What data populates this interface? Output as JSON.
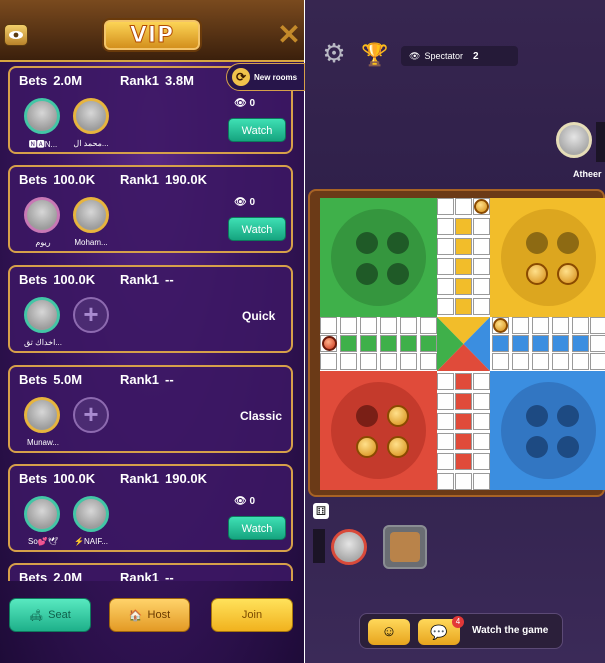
{
  "left": {
    "title": "VIP",
    "new_rooms_label": "New rooms",
    "rooms": [
      {
        "bets_label": "Bets",
        "bets": "2.0M",
        "rank_label": "Rank1",
        "rank": "3.8M",
        "players": [
          "🅽🅰N...",
          "محمد ال..."
        ],
        "watchers": "0",
        "action": "Watch"
      },
      {
        "bets_label": "Bets",
        "bets": "100.0K",
        "rank_label": "Rank1",
        "rank": "190.0K",
        "players": [
          "ريوم",
          "Moham..."
        ],
        "watchers": "0",
        "action": "Watch"
      },
      {
        "bets_label": "Bets",
        "bets": "100.0K",
        "rank_label": "Rank1",
        "rank": "--",
        "players": [
          "اخداك تق..."
        ],
        "mode": "Quick"
      },
      {
        "bets_label": "Bets",
        "bets": "5.0M",
        "rank_label": "Rank1",
        "rank": "--",
        "players": [
          "Munaw..."
        ],
        "mode": "Classic"
      },
      {
        "bets_label": "Bets",
        "bets": "100.0K",
        "rank_label": "Rank1",
        "rank": "190.0K",
        "players": [
          "So💕🕊",
          "⚡NAIF..."
        ],
        "watchers": "0",
        "action": "Watch"
      },
      {
        "bets_label": "Bets",
        "bets": "2.0M",
        "rank_label": "Rank1",
        "rank": "--"
      }
    ],
    "buttons": {
      "seat": "Seat",
      "host": "Host",
      "join": "Join"
    }
  },
  "right": {
    "spectator_label": "Spectator",
    "spectator_count": "2",
    "opponent_name": "Atheer",
    "watch_game_label": "Watch the game",
    "chat_badge": "4"
  }
}
